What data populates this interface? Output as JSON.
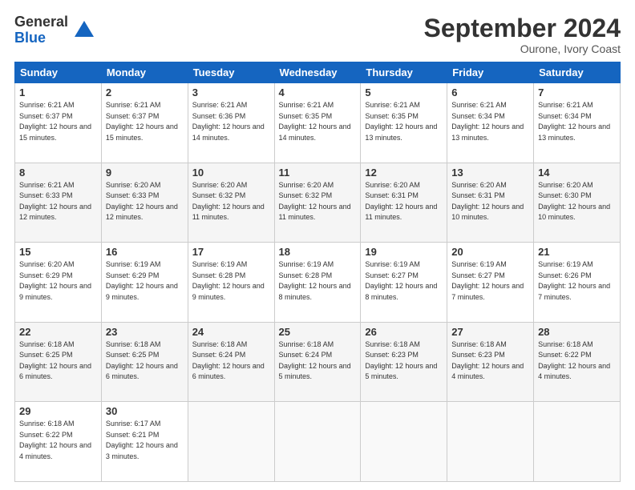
{
  "logo": {
    "line1": "General",
    "line2": "Blue"
  },
  "header": {
    "title": "September 2024",
    "location": "Ourone, Ivory Coast"
  },
  "weekdays": [
    "Sunday",
    "Monday",
    "Tuesday",
    "Wednesday",
    "Thursday",
    "Friday",
    "Saturday"
  ],
  "weeks": [
    [
      {
        "day": "1",
        "sunrise": "6:21 AM",
        "sunset": "6:37 PM",
        "daylight": "12 hours and 15 minutes."
      },
      {
        "day": "2",
        "sunrise": "6:21 AM",
        "sunset": "6:37 PM",
        "daylight": "12 hours and 15 minutes."
      },
      {
        "day": "3",
        "sunrise": "6:21 AM",
        "sunset": "6:36 PM",
        "daylight": "12 hours and 14 minutes."
      },
      {
        "day": "4",
        "sunrise": "6:21 AM",
        "sunset": "6:35 PM",
        "daylight": "12 hours and 14 minutes."
      },
      {
        "day": "5",
        "sunrise": "6:21 AM",
        "sunset": "6:35 PM",
        "daylight": "12 hours and 13 minutes."
      },
      {
        "day": "6",
        "sunrise": "6:21 AM",
        "sunset": "6:34 PM",
        "daylight": "12 hours and 13 minutes."
      },
      {
        "day": "7",
        "sunrise": "6:21 AM",
        "sunset": "6:34 PM",
        "daylight": "12 hours and 13 minutes."
      }
    ],
    [
      {
        "day": "8",
        "sunrise": "6:21 AM",
        "sunset": "6:33 PM",
        "daylight": "12 hours and 12 minutes."
      },
      {
        "day": "9",
        "sunrise": "6:20 AM",
        "sunset": "6:33 PM",
        "daylight": "12 hours and 12 minutes."
      },
      {
        "day": "10",
        "sunrise": "6:20 AM",
        "sunset": "6:32 PM",
        "daylight": "12 hours and 11 minutes."
      },
      {
        "day": "11",
        "sunrise": "6:20 AM",
        "sunset": "6:32 PM",
        "daylight": "12 hours and 11 minutes."
      },
      {
        "day": "12",
        "sunrise": "6:20 AM",
        "sunset": "6:31 PM",
        "daylight": "12 hours and 11 minutes."
      },
      {
        "day": "13",
        "sunrise": "6:20 AM",
        "sunset": "6:31 PM",
        "daylight": "12 hours and 10 minutes."
      },
      {
        "day": "14",
        "sunrise": "6:20 AM",
        "sunset": "6:30 PM",
        "daylight": "12 hours and 10 minutes."
      }
    ],
    [
      {
        "day": "15",
        "sunrise": "6:20 AM",
        "sunset": "6:29 PM",
        "daylight": "12 hours and 9 minutes."
      },
      {
        "day": "16",
        "sunrise": "6:19 AM",
        "sunset": "6:29 PM",
        "daylight": "12 hours and 9 minutes."
      },
      {
        "day": "17",
        "sunrise": "6:19 AM",
        "sunset": "6:28 PM",
        "daylight": "12 hours and 9 minutes."
      },
      {
        "day": "18",
        "sunrise": "6:19 AM",
        "sunset": "6:28 PM",
        "daylight": "12 hours and 8 minutes."
      },
      {
        "day": "19",
        "sunrise": "6:19 AM",
        "sunset": "6:27 PM",
        "daylight": "12 hours and 8 minutes."
      },
      {
        "day": "20",
        "sunrise": "6:19 AM",
        "sunset": "6:27 PM",
        "daylight": "12 hours and 7 minutes."
      },
      {
        "day": "21",
        "sunrise": "6:19 AM",
        "sunset": "6:26 PM",
        "daylight": "12 hours and 7 minutes."
      }
    ],
    [
      {
        "day": "22",
        "sunrise": "6:18 AM",
        "sunset": "6:25 PM",
        "daylight": "12 hours and 6 minutes."
      },
      {
        "day": "23",
        "sunrise": "6:18 AM",
        "sunset": "6:25 PM",
        "daylight": "12 hours and 6 minutes."
      },
      {
        "day": "24",
        "sunrise": "6:18 AM",
        "sunset": "6:24 PM",
        "daylight": "12 hours and 6 minutes."
      },
      {
        "day": "25",
        "sunrise": "6:18 AM",
        "sunset": "6:24 PM",
        "daylight": "12 hours and 5 minutes."
      },
      {
        "day": "26",
        "sunrise": "6:18 AM",
        "sunset": "6:23 PM",
        "daylight": "12 hours and 5 minutes."
      },
      {
        "day": "27",
        "sunrise": "6:18 AM",
        "sunset": "6:23 PM",
        "daylight": "12 hours and 4 minutes."
      },
      {
        "day": "28",
        "sunrise": "6:18 AM",
        "sunset": "6:22 PM",
        "daylight": "12 hours and 4 minutes."
      }
    ],
    [
      {
        "day": "29",
        "sunrise": "6:18 AM",
        "sunset": "6:22 PM",
        "daylight": "12 hours and 4 minutes."
      },
      {
        "day": "30",
        "sunrise": "6:17 AM",
        "sunset": "6:21 PM",
        "daylight": "12 hours and 3 minutes."
      },
      null,
      null,
      null,
      null,
      null
    ]
  ]
}
